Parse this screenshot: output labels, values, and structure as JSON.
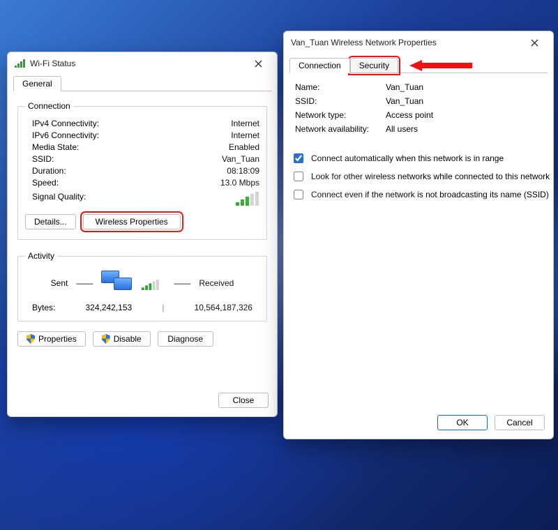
{
  "status_window": {
    "title": "Wi-Fi Status",
    "tab_general": "General",
    "group_connection": "Connection",
    "ipv4_label": "IPv4 Connectivity:",
    "ipv4_value": "Internet",
    "ipv6_label": "IPv6 Connectivity:",
    "ipv6_value": "Internet",
    "media_label": "Media State:",
    "media_value": "Enabled",
    "ssid_label": "SSID:",
    "ssid_value": "Van_Tuan",
    "duration_label": "Duration:",
    "duration_value": "08:18:09",
    "speed_label": "Speed:",
    "speed_value": "13.0 Mbps",
    "signal_label": "Signal Quality:",
    "btn_details": "Details...",
    "btn_wireless": "Wireless Properties",
    "group_activity": "Activity",
    "sent_label": "Sent",
    "received_label": "Received",
    "bytes_label": "Bytes:",
    "bytes_sent": "324,242,153",
    "bytes_recv": "10,564,187,326",
    "btn_properties": "Properties",
    "btn_disable": "Disable",
    "btn_diagnose": "Diagnose",
    "btn_close": "Close"
  },
  "props_window": {
    "title": "Van_Tuan Wireless Network Properties",
    "tab_connection": "Connection",
    "tab_security": "Security",
    "name_label": "Name:",
    "name_value": "Van_Tuan",
    "ssid_label": "SSID:",
    "ssid_value": "Van_Tuan",
    "nettype_label": "Network type:",
    "nettype_value": "Access point",
    "avail_label": "Network availability:",
    "avail_value": "All users",
    "chk_auto": "Connect automatically when this network is in range",
    "chk_look": "Look for other wireless networks while connected to this network",
    "chk_hidden": "Connect even if the network is not broadcasting its name (SSID)",
    "btn_ok": "OK",
    "btn_cancel": "Cancel"
  }
}
